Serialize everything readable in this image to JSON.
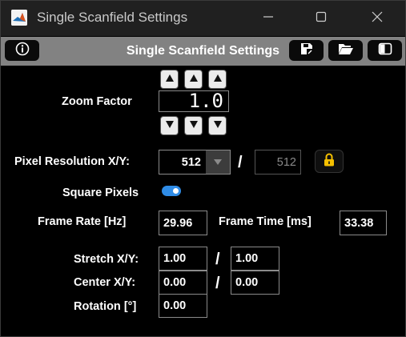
{
  "window": {
    "title": "Single Scanfield Settings",
    "app_icon": "matlab-icon",
    "controls": [
      "minimize-icon",
      "maximize-icon",
      "close-icon"
    ]
  },
  "toolbar": {
    "title": "Single Scanfield Settings",
    "left_buttons": [
      "info-icon"
    ],
    "right_buttons": [
      "save-icon",
      "open-folder-icon",
      "panel-toggle-icon"
    ]
  },
  "zoom": {
    "label": "Zoom Factor",
    "value": "1.0",
    "up_buttons": 3,
    "down_buttons": 3
  },
  "pixel_resolution": {
    "label": "Pixel Resolution X/Y:",
    "x_value": "512",
    "separator": "/",
    "y_value": "512",
    "lock_icon": "lock-icon"
  },
  "square_pixels": {
    "label": "Square Pixels",
    "enabled": true
  },
  "frame_rate": {
    "label": "Frame Rate [Hz]",
    "value": "29.96"
  },
  "frame_time": {
    "label": "Frame Time [ms]",
    "value": "33.38"
  },
  "stretch": {
    "label": "Stretch X/Y:",
    "x_value": "1.00",
    "separator": "/",
    "y_value": "1.00"
  },
  "center": {
    "label": "Center X/Y:",
    "x_value": "0.00",
    "separator": "/",
    "y_value": "0.00"
  },
  "rotation": {
    "label": "Rotation [°]",
    "value": "0.00"
  },
  "colors": {
    "titlebar_bg": "#202020",
    "toolbar_bg": "#828282",
    "content_bg": "#000000",
    "toggle_accent": "#2f8ce6",
    "lock_accent": "#f5c000"
  }
}
